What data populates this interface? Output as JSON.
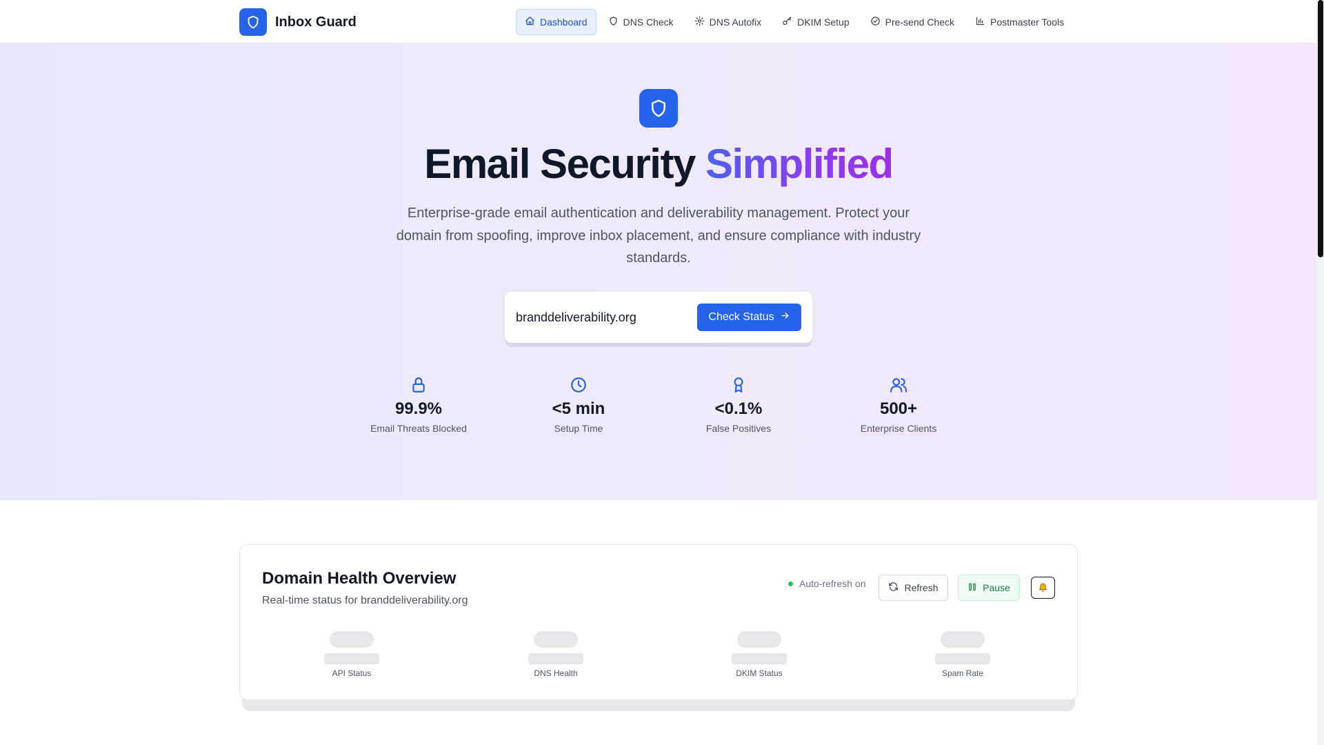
{
  "brand": {
    "name": "Inbox Guard",
    "logo_icon": "shield-icon",
    "accent_color": "#2563eb"
  },
  "nav": [
    {
      "label": "Dashboard",
      "icon": "home-icon",
      "active": true
    },
    {
      "label": "DNS Check",
      "icon": "shield-icon",
      "active": false
    },
    {
      "label": "DNS Autofix",
      "icon": "gear-icon",
      "active": false
    },
    {
      "label": "DKIM Setup",
      "icon": "key-icon",
      "active": false
    },
    {
      "label": "Pre-send Check",
      "icon": "check-circle-icon",
      "active": false
    },
    {
      "label": "Postmaster Tools",
      "icon": "bar-chart-icon",
      "active": false
    }
  ],
  "hero": {
    "title_main": "Email Security",
    "title_accent": "Simplified",
    "subtitle": "Enterprise-grade email authentication and deliverability management. Protect your domain from spoofing, improve inbox placement, and ensure compliance with industry standards.",
    "domain_value": "branddeliverability.org",
    "check_label": "Check Status"
  },
  "stats": [
    {
      "value": "99.9%",
      "label": "Email Threats Blocked",
      "icon": "lock-icon"
    },
    {
      "value": "<5 min",
      "label": "Setup Time",
      "icon": "clock-icon"
    },
    {
      "value": "<0.1%",
      "label": "False Positives",
      "icon": "award-icon"
    },
    {
      "value": "500+",
      "label": "Enterprise Clients",
      "icon": "users-icon"
    }
  ],
  "health": {
    "title": "Domain Health Overview",
    "subtitle": "Real-time status for branddeliverability.org",
    "auto_refresh": "Auto-refresh on",
    "refresh_label": "Refresh",
    "pause_label": "Pause",
    "bell_icon": "bell-icon",
    "metrics": [
      "API Status",
      "DNS Health",
      "DKIM Status",
      "Spam Rate"
    ]
  }
}
